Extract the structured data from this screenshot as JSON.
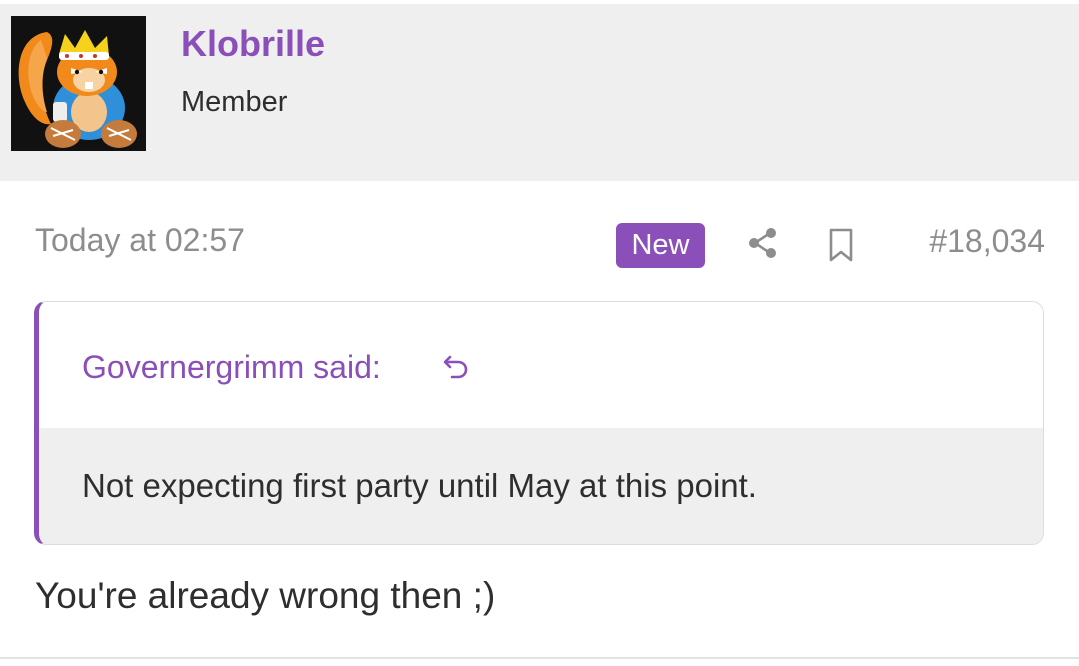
{
  "user": {
    "name": "Klobrille",
    "title": "Member",
    "avatar_icon": "squirrel-king-avatar"
  },
  "post": {
    "time": "Today at 02:57",
    "new_badge": "New",
    "share_icon": "share-icon",
    "bookmark_icon": "bookmark-icon",
    "number": "#18,034",
    "quote": {
      "author_line": "Governergrimm said:",
      "jump_icon": "reply-arrow-icon",
      "text": "Not expecting first party until May at this point."
    },
    "body": "You're already wrong then ;)"
  },
  "colors": {
    "accent": "#8a4fb8",
    "header_bg": "#efefef",
    "muted_text": "#8d8d8d",
    "body_text": "#2e2e2e"
  }
}
